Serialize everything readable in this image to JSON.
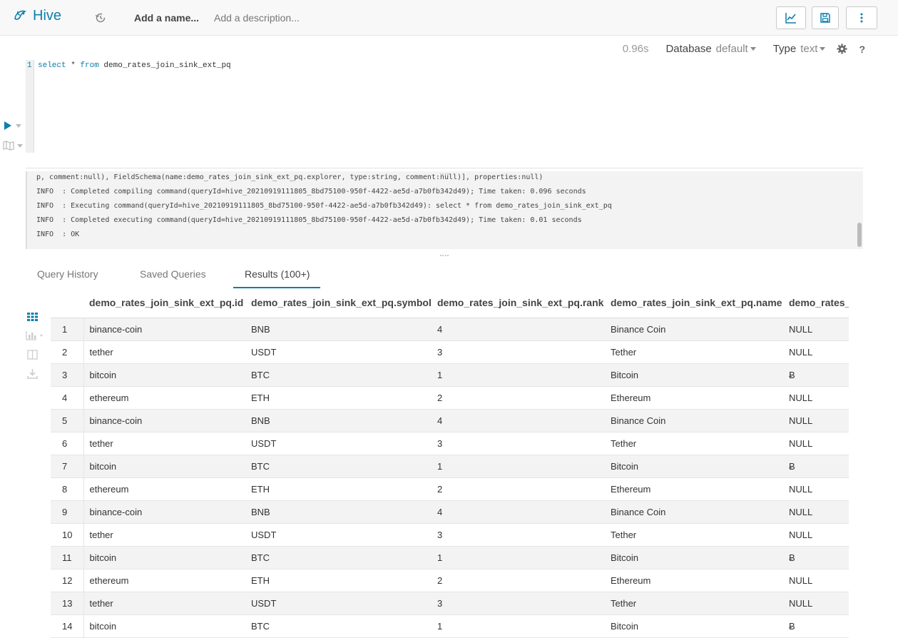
{
  "app": {
    "name": "Hive",
    "snippet_name": "Add a name...",
    "snippet_description": "Add a description..."
  },
  "status": {
    "time": "0.96s",
    "database_label": "Database",
    "database_value": "default",
    "type_label": "Type",
    "type_value": "text"
  },
  "editor": {
    "line_number": "1",
    "keyword_select": "select",
    "star": " * ",
    "keyword_from": "from",
    "table_name": " demo_rates_join_sink_ext_pq"
  },
  "logs": [
    "p, comment:null), FieldSchema(name:demo_rates_join_sink_ext_pq.explorer, type:string, comment:null)], properties:null)",
    "INFO  : Completed compiling command(queryId=hive_20210919111805_8bd75100-950f-4422-ae5d-a7b0fb342d49); Time taken: 0.096 seconds",
    "INFO  : Executing command(queryId=hive_20210919111805_8bd75100-950f-4422-ae5d-a7b0fb342d49): select * from demo_rates_join_sink_ext_pq",
    "INFO  : Completed executing command(queryId=hive_20210919111805_8bd75100-950f-4422-ae5d-a7b0fb342d49); Time taken: 0.01 seconds",
    "INFO  : OK"
  ],
  "tabs": {
    "history": "Query History",
    "saved": "Saved Queries",
    "results": "Results (100+)"
  },
  "table": {
    "columns": [
      "demo_rates_join_sink_ext_pq.id",
      "demo_rates_join_sink_ext_pq.symbol",
      "demo_rates_join_sink_ext_pq.rank",
      "demo_rates_join_sink_ext_pq.name",
      "demo_rates_join_sink_ext_pq.explorer"
    ],
    "rows": [
      [
        "1",
        "binance-coin",
        "BNB",
        "4",
        "Binance Coin",
        "NULL"
      ],
      [
        "2",
        "tether",
        "USDT",
        "3",
        "Tether",
        "NULL"
      ],
      [
        "3",
        "bitcoin",
        "BTC",
        "1",
        "Bitcoin",
        "Ƀ"
      ],
      [
        "4",
        "ethereum",
        "ETH",
        "2",
        "Ethereum",
        "NULL"
      ],
      [
        "5",
        "binance-coin",
        "BNB",
        "4",
        "Binance Coin",
        "NULL"
      ],
      [
        "6",
        "tether",
        "USDT",
        "3",
        "Tether",
        "NULL"
      ],
      [
        "7",
        "bitcoin",
        "BTC",
        "1",
        "Bitcoin",
        "Ƀ"
      ],
      [
        "8",
        "ethereum",
        "ETH",
        "2",
        "Ethereum",
        "NULL"
      ],
      [
        "9",
        "binance-coin",
        "BNB",
        "4",
        "Binance Coin",
        "NULL"
      ],
      [
        "10",
        "tether",
        "USDT",
        "3",
        "Tether",
        "NULL"
      ],
      [
        "11",
        "bitcoin",
        "BTC",
        "1",
        "Bitcoin",
        "Ƀ"
      ],
      [
        "12",
        "ethereum",
        "ETH",
        "2",
        "Ethereum",
        "NULL"
      ],
      [
        "13",
        "tether",
        "USDT",
        "3",
        "Tether",
        "NULL"
      ],
      [
        "14",
        "bitcoin",
        "BTC",
        "1",
        "Bitcoin",
        "Ƀ"
      ]
    ]
  },
  "icons": {
    "brand": "hive-bee-icon",
    "history": "history-icon",
    "chart": "line-chart-icon",
    "save": "floppy-save-icon",
    "more": "vertical-dots-icon",
    "settings": "gear-icon",
    "help": "question-icon",
    "run": "play-icon",
    "map": "map-icon",
    "grid": "grid-icon",
    "bar": "bar-chart-icon",
    "columns": "columns-icon",
    "download": "download-icon"
  },
  "colors": {
    "accent": "#0b7fad",
    "stripe": "#f3f3f3"
  }
}
